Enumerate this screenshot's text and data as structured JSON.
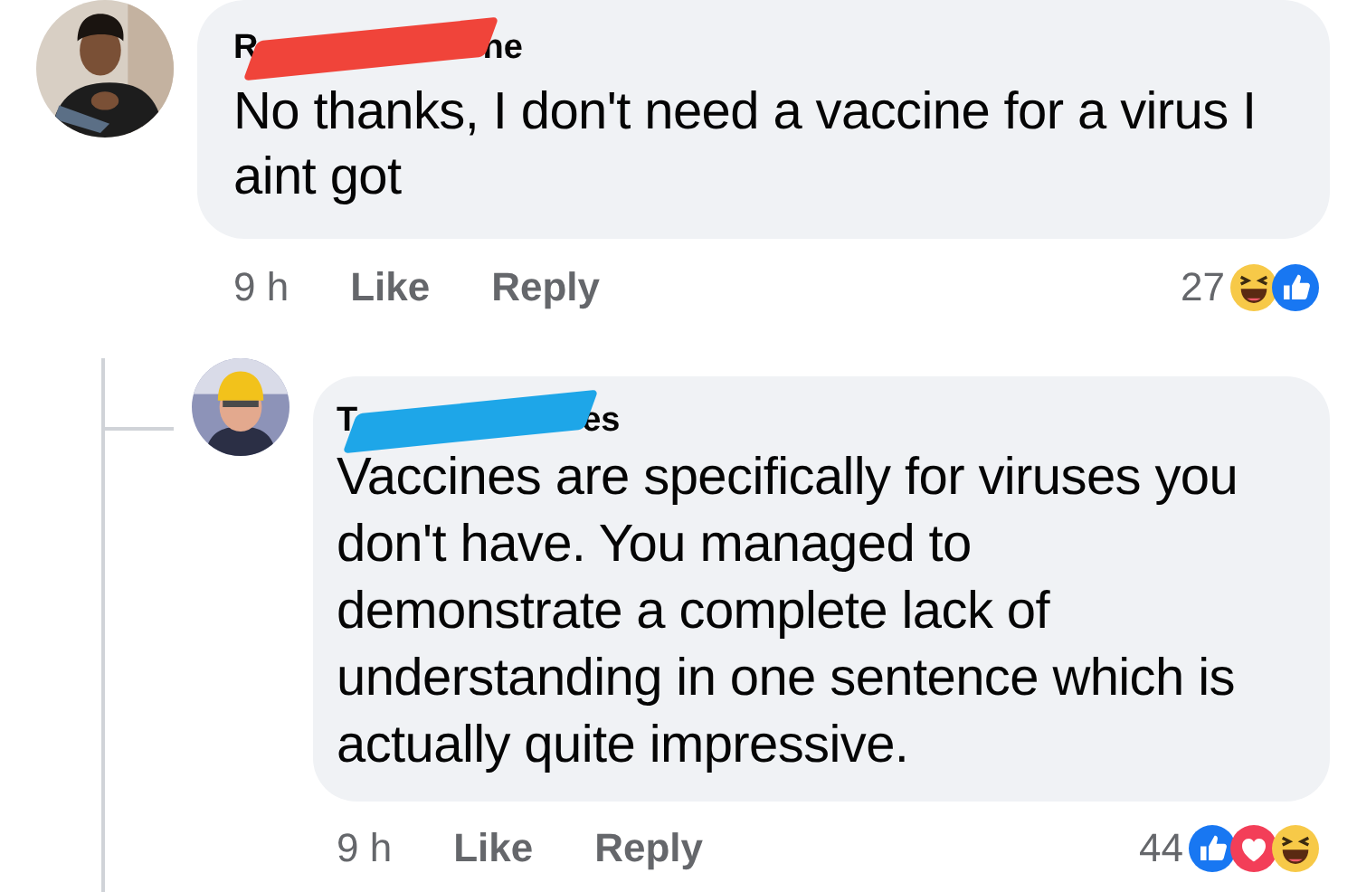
{
  "comments": [
    {
      "name_start": "R",
      "name_end": "ne",
      "color": "#f0443a",
      "text": "No thanks, I don't need a vaccine for a virus I aint got",
      "time": "9 h",
      "like": "Like",
      "reply": "Reply",
      "reaction_count": "27",
      "reactions": [
        {
          "kind": "haha"
        },
        {
          "kind": "like"
        }
      ],
      "replies": [
        {
          "name_start": "T",
          "name_end": "es",
          "color": "#1ea6e8",
          "text": "Vaccines are specifically for viruses you don't have. You managed to demonstrate a complete lack of understanding in one sentence which is actually quite impressive.",
          "time": "9 h",
          "like": "Like",
          "reply": "Reply",
          "reaction_count": "44",
          "reactions": [
            {
              "kind": "like"
            },
            {
              "kind": "love"
            },
            {
              "kind": "haha"
            }
          ]
        }
      ]
    }
  ]
}
